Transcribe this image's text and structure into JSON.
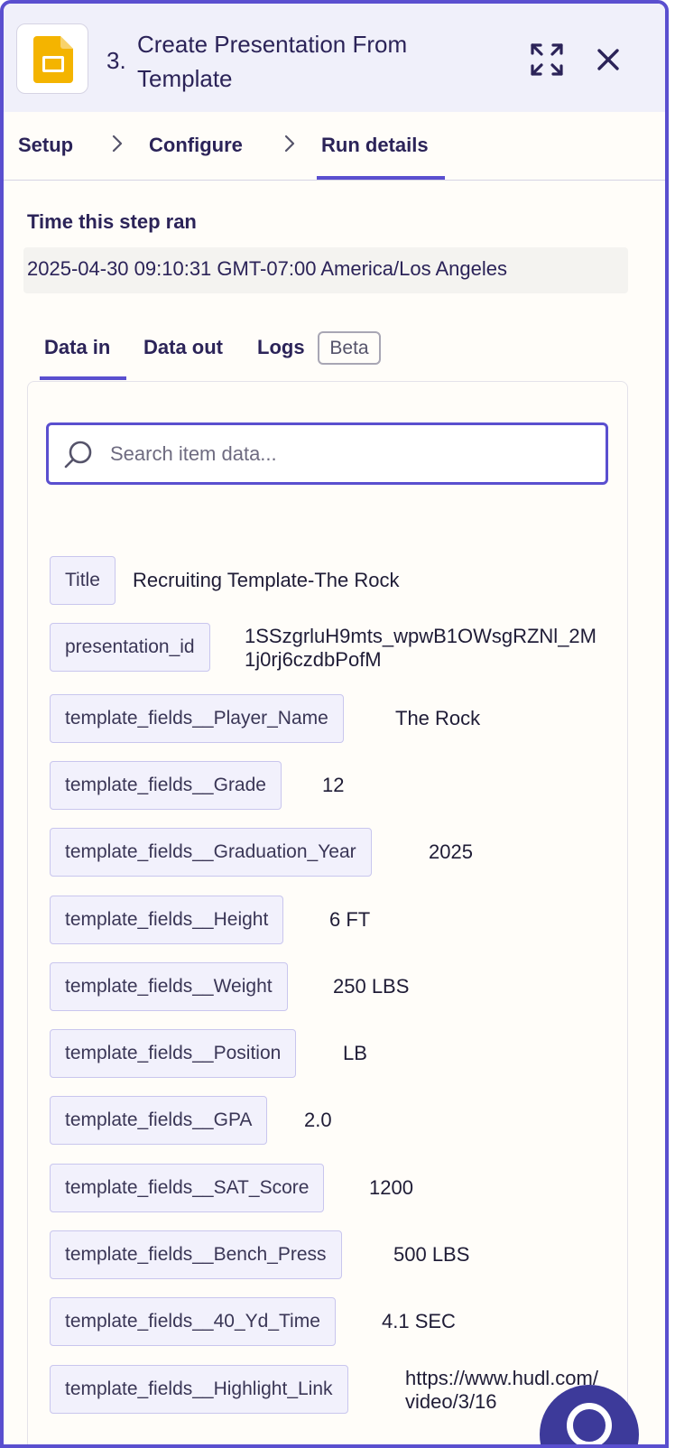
{
  "header": {
    "step_number": "3.",
    "title": "Create Presentation From Template",
    "app_icon": "google-slides-icon",
    "expand_icon": "expand-icon",
    "close_icon": "close-icon"
  },
  "nav": {
    "items": [
      {
        "label": "Setup"
      },
      {
        "label": "Configure"
      },
      {
        "label": "Run details"
      }
    ],
    "active": "Run details"
  },
  "time": {
    "label": "Time this step ran",
    "value": "2025-04-30 09:10:31 GMT-07:00 America/Los Angeles"
  },
  "tabs": {
    "items": [
      {
        "label": "Data in"
      },
      {
        "label": "Data out"
      },
      {
        "label": "Logs"
      }
    ],
    "badge": "Beta",
    "active": "Data in"
  },
  "search": {
    "placeholder": "Search item data..."
  },
  "data_in": [
    {
      "key": "Title",
      "value": "Recruiting Template-The Rock"
    },
    {
      "key": "presentation_id",
      "value": "1SSzgrluH9mts_wpwB1OWsgRZNl_2M1j0rj6czdbPofM"
    },
    {
      "key": "template_fields__Player_Name",
      "value": "The Rock"
    },
    {
      "key": "template_fields__Grade",
      "value": "12"
    },
    {
      "key": "template_fields__Graduation_Year",
      "value": "2025"
    },
    {
      "key": "template_fields__Height",
      "value": "6 FT"
    },
    {
      "key": "template_fields__Weight",
      "value": "250 LBS"
    },
    {
      "key": "template_fields__Position",
      "value": "LB"
    },
    {
      "key": "template_fields__GPA",
      "value": "2.0"
    },
    {
      "key": "template_fields__SAT_Score",
      "value": "1200"
    },
    {
      "key": "template_fields__Bench_Press",
      "value": "500 LBS"
    },
    {
      "key": "template_fields__40_Yd_Time",
      "value": "4.1 SEC"
    },
    {
      "key": "template_fields__Highlight_Link",
      "value": "https://www.hudl.com/video/3/16"
    }
  ],
  "colors": {
    "accent": "#5a4fcf",
    "header_bg": "#f0f0fa",
    "key_bg": "#f2f1fc",
    "google_slides_yellow": "#f4b400"
  }
}
